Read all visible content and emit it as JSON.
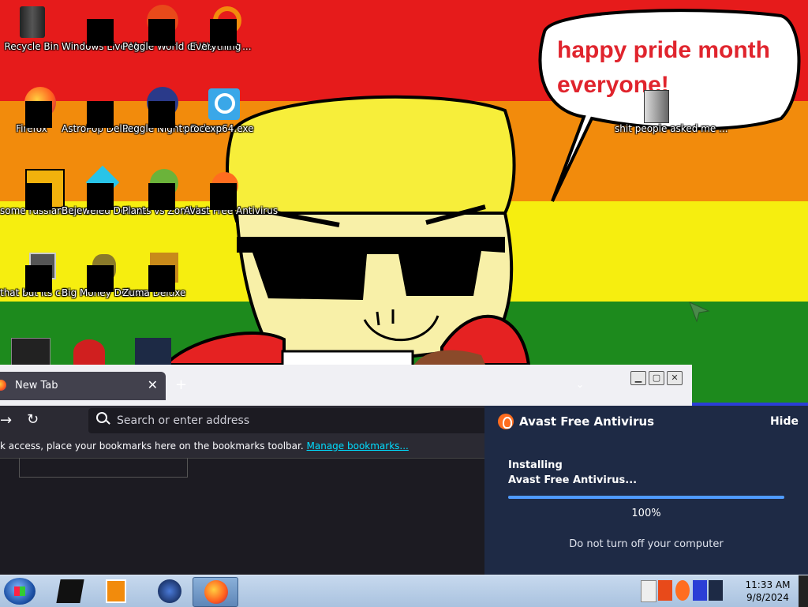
{
  "desktop": {
    "speech_bubble_text": "happy pride month everyone!",
    "icons": [
      {
        "name": "recycle-bin-icon",
        "label": "Recycle Bin"
      },
      {
        "name": "windows-live-mail-icon",
        "label": "Windows Live Mail"
      },
      {
        "name": "peggle-world-of-warcraft-icon",
        "label": "Peggle World of Warcraft ..."
      },
      {
        "name": "everything-icon",
        "label": "Everything"
      },
      {
        "name": "firefox-icon",
        "label": "Firefox"
      },
      {
        "name": "astropop-deluxe-icon",
        "label": "AstroPop Deluxe"
      },
      {
        "name": "peggle-nights-deluxe-icon",
        "label": "Peggle Nights Deluxe"
      },
      {
        "name": "procexp64-icon",
        "label": "procexp64.exe"
      },
      {
        "name": "some-russian-ran-a-rat-icon",
        "label": "some russian ran a rat"
      },
      {
        "name": "bejeweled-deluxe-icon",
        "label": "Bejeweled Deluxe"
      },
      {
        "name": "plants-vs-zombies-icon",
        "label": "Plants vs Zombies"
      },
      {
        "name": "avast-free-antivirus-icon",
        "label": "Avast Free Antivirus"
      },
      {
        "name": "that-but-its-csharp-icon",
        "label": "that but its c#"
      },
      {
        "name": "big-money-deluxe-icon",
        "label": "Big Money Deluxe"
      },
      {
        "name": "zuma-deluxe-icon",
        "label": "Zuma Deluxe"
      },
      {
        "name": "folder-icon",
        "label": "shit people asked me ..."
      }
    ]
  },
  "browser": {
    "tab_label": "New Tab",
    "tab_close": "✕",
    "new_tab": "+",
    "tab_list": "⌄",
    "nav_forward": "→",
    "nav_reload": "↻",
    "search_placeholder": "Search or enter address",
    "bookmarks_hint": "k access, place your bookmarks here on the bookmarks toolbar.",
    "manage_bookmarks": "Manage bookmarks...",
    "window_buttons": {
      "minimize": "▁",
      "maximize": "▢",
      "close": "✕"
    }
  },
  "avast_popup": {
    "title": "Avast Free Antivirus",
    "hide_label": "Hide",
    "installing_line1": "Installing",
    "installing_line2": "Avast Free Antivirus...",
    "progress": 1.0,
    "progress_text": "100%",
    "warning": "Do not turn off your computer"
  },
  "taskbar": {
    "time": "11:33 AM",
    "date": "9/8/2024"
  },
  "colors": {
    "pride_red": "#e61b1b",
    "pride_orange": "#f28b0c",
    "pride_yellow": "#f6ee0f",
    "pride_green": "#1d8a1d",
    "avast_bg": "#1e2a45",
    "avast_accent": "#ff6d1f"
  }
}
